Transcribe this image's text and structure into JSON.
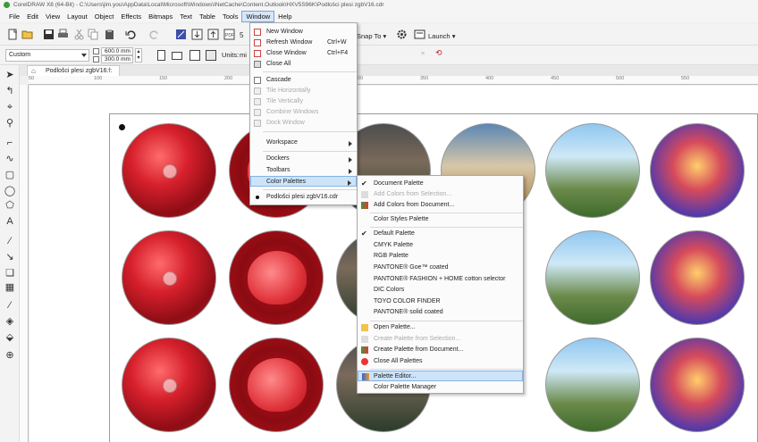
{
  "window": {
    "title": "CorelDRAW X8 (64-Bit) - C:\\Users\\jim.you\\AppData\\Local\\Microsoft\\Windows\\INetCache\\Content.Outlook\\HXV5S96K\\Podlošci plesi zgbV16.cdr"
  },
  "menubar": {
    "items": [
      "File",
      "Edit",
      "View",
      "Layout",
      "Object",
      "Effects",
      "Bitmaps",
      "Text",
      "Table",
      "Tools",
      "Window",
      "Help"
    ],
    "active": "Window"
  },
  "toolbar1": {
    "snap_to": "Snap To",
    "launch": "Launch"
  },
  "propertybar": {
    "page_size": "Custom",
    "width": "600.0 mm",
    "height": "300.0 mm",
    "units_label": "Units:",
    "units_value": "mi"
  },
  "document_tab": {
    "label": "Podlošci plesi zgbV16...",
    "add": "+"
  },
  "ruler": {
    "ticks": [
      "50",
      "100",
      "150",
      "200",
      "250",
      "300",
      "350",
      "400",
      "450",
      "500",
      "550"
    ]
  },
  "window_menu": {
    "items": [
      {
        "label": "New Window",
        "shortcut": "",
        "icon": "new-window-icon"
      },
      {
        "label": "Refresh Window",
        "shortcut": "Ctrl+W",
        "icon": "refresh-window-icon"
      },
      {
        "label": "Close Window",
        "shortcut": "Ctrl+F4",
        "icon": "close-window-icon"
      },
      {
        "label": "Close All",
        "shortcut": "",
        "icon": "close-all-icon"
      },
      {
        "label": "Cascade",
        "shortcut": "",
        "icon": "cascade-icon"
      },
      {
        "label": "Tile Horizontally",
        "shortcut": "",
        "icon": "tile-horizontal-icon",
        "disabled": true
      },
      {
        "label": "Tile Vertically",
        "shortcut": "",
        "icon": "tile-vertical-icon",
        "disabled": true
      },
      {
        "label": "Combine Windows",
        "shortcut": "",
        "icon": "combine-windows-icon",
        "disabled": true
      },
      {
        "label": "Dock Window",
        "shortcut": "",
        "icon": "dock-window-icon",
        "disabled": true
      },
      {
        "label": "Workspace",
        "shortcut": "",
        "submenu": true
      },
      {
        "label": "Dockers",
        "shortcut": "",
        "submenu": true
      },
      {
        "label": "Toolbars",
        "shortcut": "",
        "submenu": true
      },
      {
        "label": "Color Palettes",
        "shortcut": "",
        "submenu": true,
        "highlighted": true
      },
      {
        "label": "Podlošci plesi zgbV16.cdr",
        "shortcut": "",
        "bullet": true
      }
    ]
  },
  "palettes_menu": {
    "items": [
      {
        "label": "Document Palette",
        "checked": true
      },
      {
        "label": "Add Colors from Selection...",
        "disabled": true,
        "icon": "add-from-selection-icon"
      },
      {
        "label": "Add Colors from Document...",
        "icon": "add-from-document-icon"
      },
      {
        "label": "Color Styles Palette"
      },
      {
        "label": "Default Palette",
        "checked": true
      },
      {
        "label": "CMYK Palette"
      },
      {
        "label": "RGB Palette"
      },
      {
        "label": "PANTONE® Goe™ coated"
      },
      {
        "label": "PANTONE® FASHION + HOME cotton selector"
      },
      {
        "label": "DIC Colors"
      },
      {
        "label": "TOYO COLOR FINDER"
      },
      {
        "label": "PANTONE® solid coated"
      },
      {
        "label": "Open Palette...",
        "icon": "open-palette-icon"
      },
      {
        "label": "Create Palette from Selection...",
        "disabled": true,
        "icon": "create-from-selection-icon"
      },
      {
        "label": "Create Palette from Document...",
        "icon": "create-from-document-icon"
      },
      {
        "label": "Close All Palettes",
        "icon": "close-all-palettes-icon"
      },
      {
        "label": "Palette Editor...",
        "highlighted": true,
        "icon": "palette-editor-icon"
      },
      {
        "label": "Color Palette Manager"
      }
    ]
  },
  "colors": {
    "menu_highlight": "#cde3f8",
    "accent_border": "#86b3e3",
    "coreldraw_green": "#3a9a3a"
  }
}
